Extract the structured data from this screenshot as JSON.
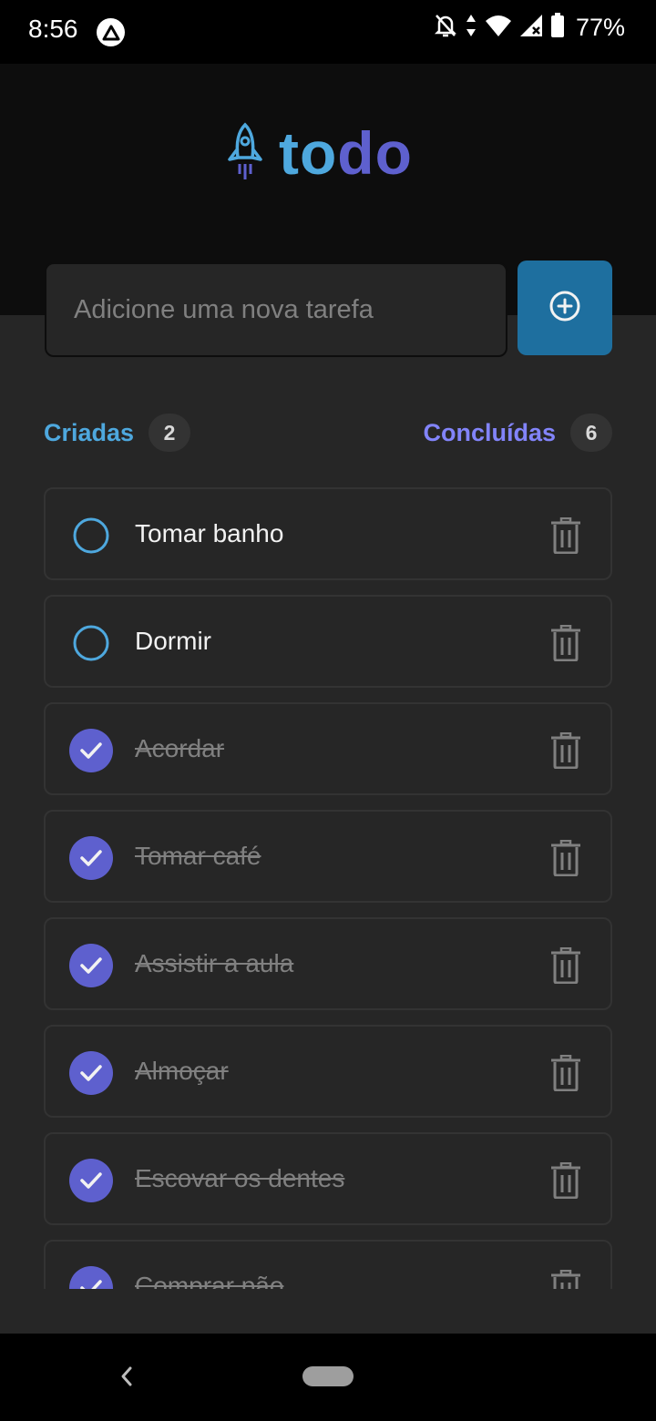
{
  "status_bar": {
    "time": "8:56",
    "battery": "77%",
    "icons": [
      "app-badge-icon",
      "notifications-off-icon",
      "data-arrows-icon",
      "wifi-icon",
      "signal-icon",
      "battery-icon"
    ]
  },
  "header": {
    "logo_icon": "rocket-icon",
    "logo_part1": "to",
    "logo_part2": "do",
    "logo_colors": {
      "to": "#4ea8de",
      "do": "#5e60ce"
    }
  },
  "new_task": {
    "placeholder": "Adicione uma nova tarefa",
    "add_icon": "plus-circle-icon"
  },
  "counters": {
    "created_label": "Criadas",
    "created_count": "2",
    "done_label": "Concluídas",
    "done_count": "6"
  },
  "tasks": [
    {
      "text": "Tomar banho",
      "done": false
    },
    {
      "text": "Dormir",
      "done": false
    },
    {
      "text": "Acordar",
      "done": true
    },
    {
      "text": "Tomar café",
      "done": true
    },
    {
      "text": "Assistir a aula",
      "done": true
    },
    {
      "text": "Almoçar",
      "done": true
    },
    {
      "text": "Escovar os dentes",
      "done": true
    },
    {
      "text": "Comprar pão",
      "done": true
    }
  ],
  "colors": {
    "accent_blue": "#4ea8de",
    "accent_purple": "#8284fa",
    "button_blue": "#1e6f9f",
    "check_purple": "#5e60ce"
  },
  "nav": {
    "back_icon": "back-chevron-icon",
    "home_icon": "home-pill-icon"
  }
}
